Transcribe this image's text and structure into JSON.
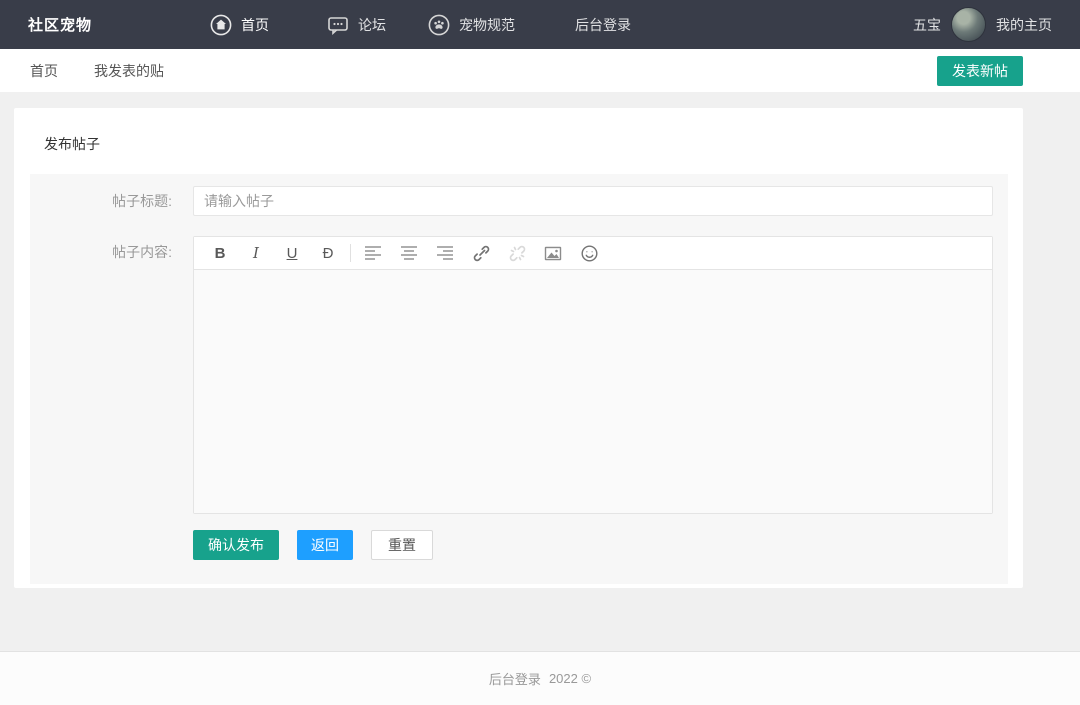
{
  "brand": "社区宠物",
  "navbar": {
    "items": [
      {
        "label": "首页",
        "icon": "home-icon"
      },
      {
        "label": "论坛",
        "icon": "forum-icon"
      },
      {
        "label": "宠物规范",
        "icon": "paw-icon"
      },
      {
        "label": "后台登录",
        "icon": ""
      }
    ],
    "username": "五宝",
    "profile_link": "我的主页"
  },
  "breadcrumb": {
    "home": "首页",
    "my_posts": "我发表的贴",
    "new_post_button": "发表新帖"
  },
  "post_form": {
    "card_title": "发布帖子",
    "title_label": "帖子标题:",
    "title_placeholder": "请输入帖子",
    "content_label": "帖子内容:",
    "editor": {
      "bold": "B",
      "italic": "I",
      "underline": "U",
      "strikethrough": "Đ"
    },
    "buttons": {
      "submit": "确认发布",
      "back": "返回",
      "reset": "重置"
    }
  },
  "footer": {
    "link": "后台登录",
    "copyright": "2022 ©"
  },
  "colors": {
    "navbar_bg": "#393D49",
    "accent_teal": "#17a28c",
    "accent_blue": "#1E9FFF",
    "page_bg": "#f0f0f0"
  }
}
